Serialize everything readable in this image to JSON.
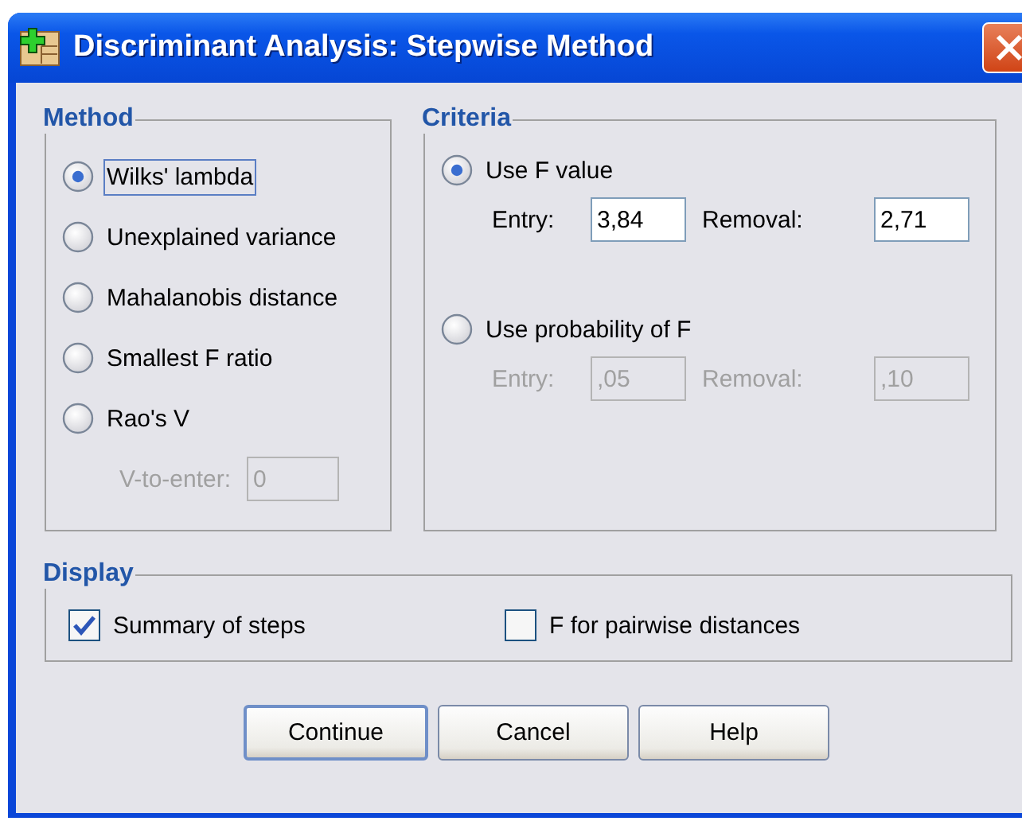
{
  "window": {
    "title": "Discriminant Analysis: Stepwise Method"
  },
  "method": {
    "title": "Method",
    "options": [
      {
        "label": "Wilks' lambda",
        "selected": true,
        "focused": true
      },
      {
        "label": "Unexplained variance",
        "selected": false,
        "focused": false
      },
      {
        "label": "Mahalanobis distance",
        "selected": false,
        "focused": false
      },
      {
        "label": "Smallest F ratio",
        "selected": false,
        "focused": false
      },
      {
        "label": "Rao's V",
        "selected": false,
        "focused": false
      }
    ],
    "v_to_enter": {
      "label": "V-to-enter:",
      "value": "0",
      "disabled": true
    }
  },
  "criteria": {
    "title": "Criteria",
    "options": [
      {
        "label": "Use F value",
        "selected": true,
        "fields": [
          {
            "label": "Entry:",
            "value": "3,84",
            "disabled": false
          },
          {
            "label": "Removal:",
            "value": "2,71",
            "disabled": false
          }
        ]
      },
      {
        "label": "Use probability of F",
        "selected": false,
        "fields": [
          {
            "label": "Entry:",
            "value": ",05",
            "disabled": true
          },
          {
            "label": "Removal:",
            "value": ",10",
            "disabled": true
          }
        ]
      }
    ]
  },
  "display": {
    "title": "Display",
    "options": [
      {
        "label": "Summary of steps",
        "checked": true
      },
      {
        "label": "F for pairwise distances",
        "checked": false
      }
    ]
  },
  "buttons": [
    {
      "label": "Continue",
      "default": true
    },
    {
      "label": "Cancel",
      "default": false
    },
    {
      "label": "Help",
      "default": false
    }
  ]
}
